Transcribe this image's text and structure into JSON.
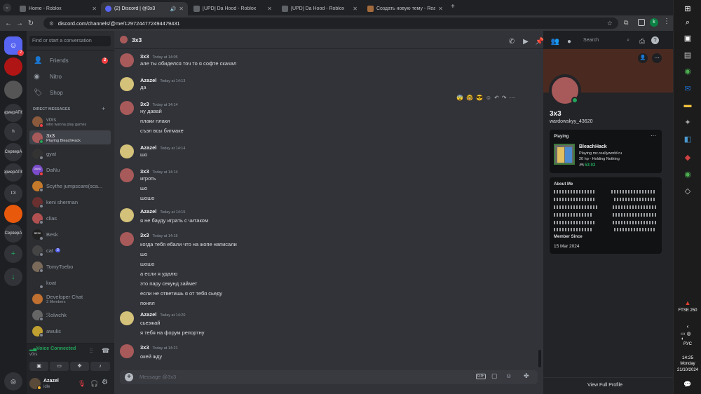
{
  "browser": {
    "tabs": [
      {
        "title": "Home - Roblox",
        "color": "#5f6368"
      },
      {
        "title": "(2) Discord | @3x3",
        "color": "#5865f2"
      },
      {
        "title": "[UPD] Da Hood - Roblox",
        "color": "#5f6368"
      },
      {
        "title": "[UPD] Da Hood - Roblox",
        "color": "#5f6368"
      },
      {
        "title": "Создать новую тему - ReallyW",
        "color": "#a36b3b"
      }
    ],
    "url": "discord.com/channels/@me/1297244772494479431"
  },
  "servers": [
    {
      "label": "",
      "color": "#5865f2",
      "badge": "2"
    },
    {
      "label": "",
      "color": "#b01515"
    },
    {
      "label": "",
      "color": "#555"
    },
    {
      "label": "вриерАПб",
      "color": "#313338"
    },
    {
      "label": "h",
      "color": "#313338"
    },
    {
      "label": "СерверA",
      "color": "#313338"
    },
    {
      "label": "вриерАПб",
      "color": "#313338"
    },
    {
      "label": "t:3",
      "color": "#313338"
    },
    {
      "label": "",
      "color": "#e8590c"
    },
    {
      "label": "СерверA",
      "color": "#313338"
    }
  ],
  "sidebar": {
    "search_placeholder": "Find or start a conversation",
    "nav": [
      {
        "label": "Friends",
        "badge": "2"
      },
      {
        "label": "Nitro"
      },
      {
        "label": "Shop"
      }
    ],
    "dm_header": "DIRECT MESSAGES",
    "dms": [
      {
        "name": "v0rs",
        "sub": "who wanna play games",
        "color": "#8b5a3c",
        "status": "#f23f43"
      },
      {
        "name": "3x3",
        "sub": "Playing BleachHack",
        "color": "#a85a5a",
        "status": "#23a55a",
        "active": true
      },
      {
        "name": "gyat",
        "sub": "",
        "color": "#333",
        "status": "#80848e"
      },
      {
        "name": "DaNu",
        "sub": "",
        "color": "#7a4cc9",
        "status": "#f23f43",
        "avtext": "DANU"
      },
      {
        "name": "Scythe jumpscare(sca...",
        "sub": "",
        "color": "#c47a2a",
        "status": "#80848e"
      },
      {
        "name": "keni sherman",
        "sub": "",
        "color": "#6a3030",
        "status": "#80848e"
      },
      {
        "name": "clias",
        "sub": "",
        "color": "#b05050",
        "status": "#80848e"
      },
      {
        "name": "Besk",
        "sub": "",
        "color": "#222",
        "status": "#80848e",
        "avtext": "BESK"
      },
      {
        "name": "cat",
        "sub": "",
        "color": "#444",
        "status": "#80848e",
        "tag": "3"
      },
      {
        "name": "TomyToebo",
        "sub": "",
        "color": "#7a6a5a",
        "status": "#80848e"
      },
      {
        "name": "koat",
        "sub": "",
        "color": "#2b2d31",
        "status": "#80848e"
      },
      {
        "name": "Developer Chat",
        "sub": "3 Members",
        "color": "#c07030",
        "status": ""
      },
      {
        "name": "ℛolwchk",
        "sub": "",
        "color": "#666",
        "status": "#80848e"
      },
      {
        "name": "awulis",
        "sub": "",
        "color": "#c0a030",
        "status": "#80848e"
      }
    ],
    "voice": {
      "title": "Voice Connected",
      "channel": "v0rs"
    },
    "user": {
      "name": "Azazel",
      "status": "idle"
    }
  },
  "chat": {
    "title": "3x3",
    "search_placeholder": "Search",
    "input_placeholder": "Message @3x3",
    "groups": [
      {
        "author": "3x3",
        "time": "Today at 14:05",
        "lines": [
          "але ты обиделся точ то я софте скачал"
        ]
      },
      {
        "author": "Azazel",
        "time": "Today at 14:13",
        "lines": [
          "да"
        ]
      },
      {
        "author": "3x3",
        "time": "Today at 14:14",
        "lines": [
          "ну давай",
          "плаки плаки",
          "съэл всы бигмаке"
        ]
      },
      {
        "author": "Azazel",
        "time": "Today at 14:14",
        "lines": [
          "шо"
        ]
      },
      {
        "author": "3x3",
        "time": "Today at 14:14",
        "lines": [
          "игроть",
          "шо",
          "шошо"
        ]
      },
      {
        "author": "Azazel",
        "time": "Today at 14:15",
        "lines": [
          "я не бауду играть с читаком"
        ]
      },
      {
        "author": "3x3",
        "time": "Today at 14:15",
        "lines": [
          "когда тебя ебали что на жопе написали",
          "шо",
          "шошо",
          "а если я удалю",
          "это пару секунд займет",
          "если не ответишь я от тебя сьеду",
          "понял"
        ]
      },
      {
        "author": "Azazel",
        "time": "Today at 14:20",
        "lines": [
          "сьезжай",
          "я тебя на форум репортну"
        ]
      },
      {
        "author": "3x3",
        "time": "Today at 14:21",
        "lines": [
          "окей жду"
        ]
      }
    ]
  },
  "profile": {
    "display_name": "3x3",
    "username": "wardowskyy_43620",
    "activity_header": "Playing",
    "game_name": "BleachHack",
    "game_details": "Playing mc.reallyworld.ru",
    "game_state": "20 hp - Holding Nothing",
    "elapsed": "53:02",
    "about_header": "About Me",
    "member_since_header": "Member Since",
    "member_since": "15 Mar 2024",
    "view_full": "View Full Profile"
  },
  "taskbar": {
    "ticker": "FTSE 250",
    "lang": "РУС",
    "time": "14:25",
    "day": "Monday",
    "date": "21/10/2024"
  }
}
